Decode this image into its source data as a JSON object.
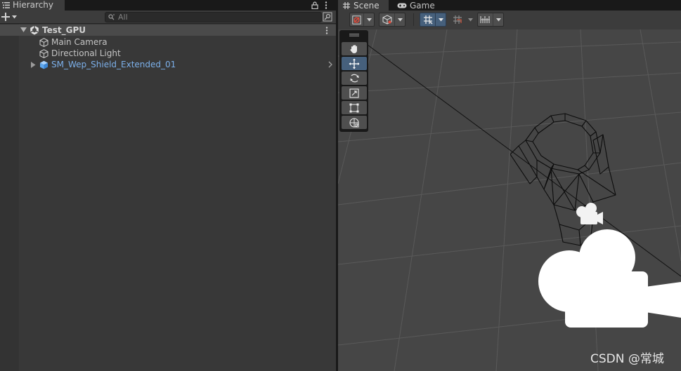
{
  "hierarchy": {
    "tab_label": "Hierarchy",
    "search_placeholder": "All",
    "scene_name": "Test_GPU",
    "items": [
      {
        "label": "Main Camera",
        "color": "#c4c4c4"
      },
      {
        "label": "Directional Light",
        "color": "#c4c4c4"
      },
      {
        "label": "SM_Wep_Shield_Extended_01",
        "color": "#7cb0ea"
      }
    ]
  },
  "scene": {
    "tabs": [
      {
        "label": "Scene",
        "icon": "hash-icon"
      },
      {
        "label": "Game",
        "icon": "gamepad-icon"
      }
    ],
    "tools": [
      "hand-tool-icon",
      "move-tool-icon",
      "rotate-tool-icon",
      "scale-tool-icon",
      "rect-tool-icon",
      "transform-tool-icon"
    ],
    "active_tool": "move-tool-icon"
  },
  "colors": {
    "panel_bg": "#383838",
    "viewport_bg": "#464646",
    "accent_blue": "#46607c",
    "prefab_text": "#7cb0ea"
  },
  "watermark": "CSDN @常城"
}
